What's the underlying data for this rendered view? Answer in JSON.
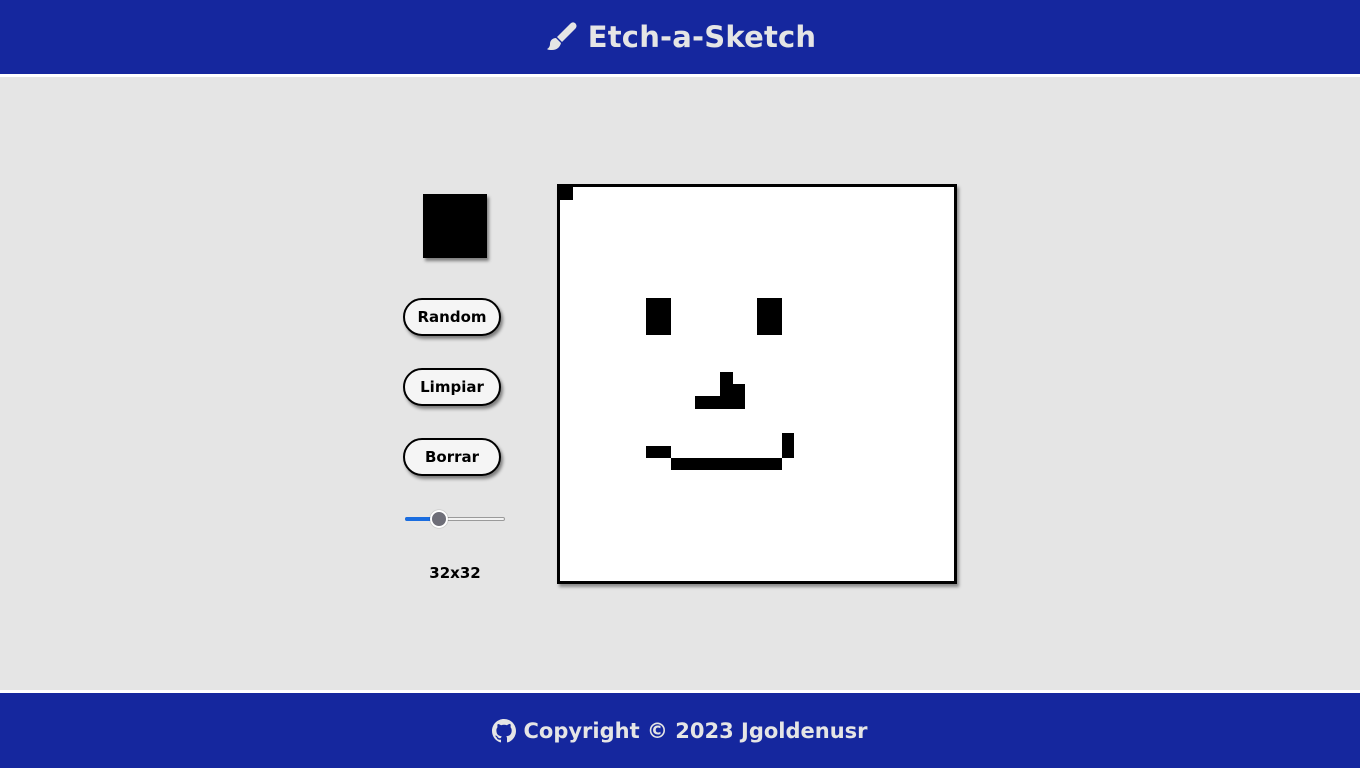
{
  "header": {
    "title": "Etch-a-Sketch",
    "icon": "paint-brush-icon"
  },
  "controls": {
    "current_color": "#000000",
    "random_label": "Random",
    "clear_label": "Limpiar",
    "erase_label": "Borrar",
    "grid_size_value": 32,
    "grid_size_min": 2,
    "grid_size_max": 100,
    "grid_size_label": "32x32"
  },
  "board": {
    "grid_size": 32,
    "ink_color": "#000000",
    "filled_cells": [
      [
        0,
        0
      ],
      [
        7,
        9
      ],
      [
        8,
        9
      ],
      [
        7,
        10
      ],
      [
        8,
        10
      ],
      [
        7,
        11
      ],
      [
        8,
        11
      ],
      [
        16,
        9
      ],
      [
        17,
        9
      ],
      [
        16,
        10
      ],
      [
        17,
        10
      ],
      [
        16,
        11
      ],
      [
        17,
        11
      ],
      [
        13,
        15
      ],
      [
        13,
        16
      ],
      [
        14,
        16
      ],
      [
        11,
        17
      ],
      [
        12,
        17
      ],
      [
        13,
        17
      ],
      [
        14,
        17
      ],
      [
        18,
        20
      ],
      [
        18,
        21
      ],
      [
        7,
        21
      ],
      [
        8,
        21
      ],
      [
        9,
        22
      ],
      [
        10,
        22
      ],
      [
        11,
        22
      ],
      [
        12,
        22
      ],
      [
        13,
        22
      ],
      [
        14,
        22
      ],
      [
        15,
        22
      ],
      [
        16,
        22
      ],
      [
        17,
        22
      ]
    ]
  },
  "footer": {
    "text": "Copyright © 2023 Jgoldenusr",
    "icon": "github-icon"
  },
  "colors": {
    "brand": "#15279e",
    "background": "#e5e5e5",
    "accent": "#1a6de0"
  }
}
